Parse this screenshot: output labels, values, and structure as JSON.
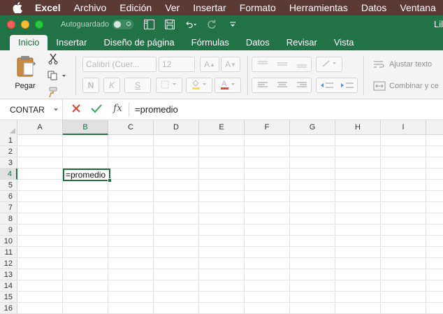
{
  "menubar": {
    "app": "Excel",
    "items": [
      "Archivo",
      "Edición",
      "Ver",
      "Insertar",
      "Formato",
      "Herramientas",
      "Datos",
      "Ventana"
    ]
  },
  "titlebar": {
    "autosave_label": "Autoguardado",
    "doc_title": "Lil"
  },
  "ribbon_tabs": [
    "Inicio",
    "Insertar",
    "Diseño de página",
    "Fórmulas",
    "Datos",
    "Revisar",
    "Vista"
  ],
  "ribbon": {
    "paste_label": "Pegar",
    "font_name": "Calibri (Cuer...",
    "font_size": "12",
    "bold": "N",
    "italic": "K",
    "underline": "S",
    "wrap_text": "Ajustar texto",
    "merge_center": "Combinar y ce"
  },
  "formula_bar": {
    "name_box": "CONTAR",
    "fx": "fx",
    "content": "=promedio"
  },
  "grid": {
    "columns": [
      "A",
      "B",
      "C",
      "D",
      "E",
      "F",
      "G",
      "H",
      "I"
    ],
    "rows": [
      "1",
      "2",
      "3",
      "4",
      "5",
      "6",
      "7",
      "8",
      "9",
      "10",
      "11",
      "12",
      "13",
      "14",
      "15",
      "16"
    ],
    "active_cell": "B4",
    "active_cell_value": "=promedio"
  },
  "colors": {
    "excel_green": "#217346",
    "menubar_bg": "#5a3a33"
  }
}
